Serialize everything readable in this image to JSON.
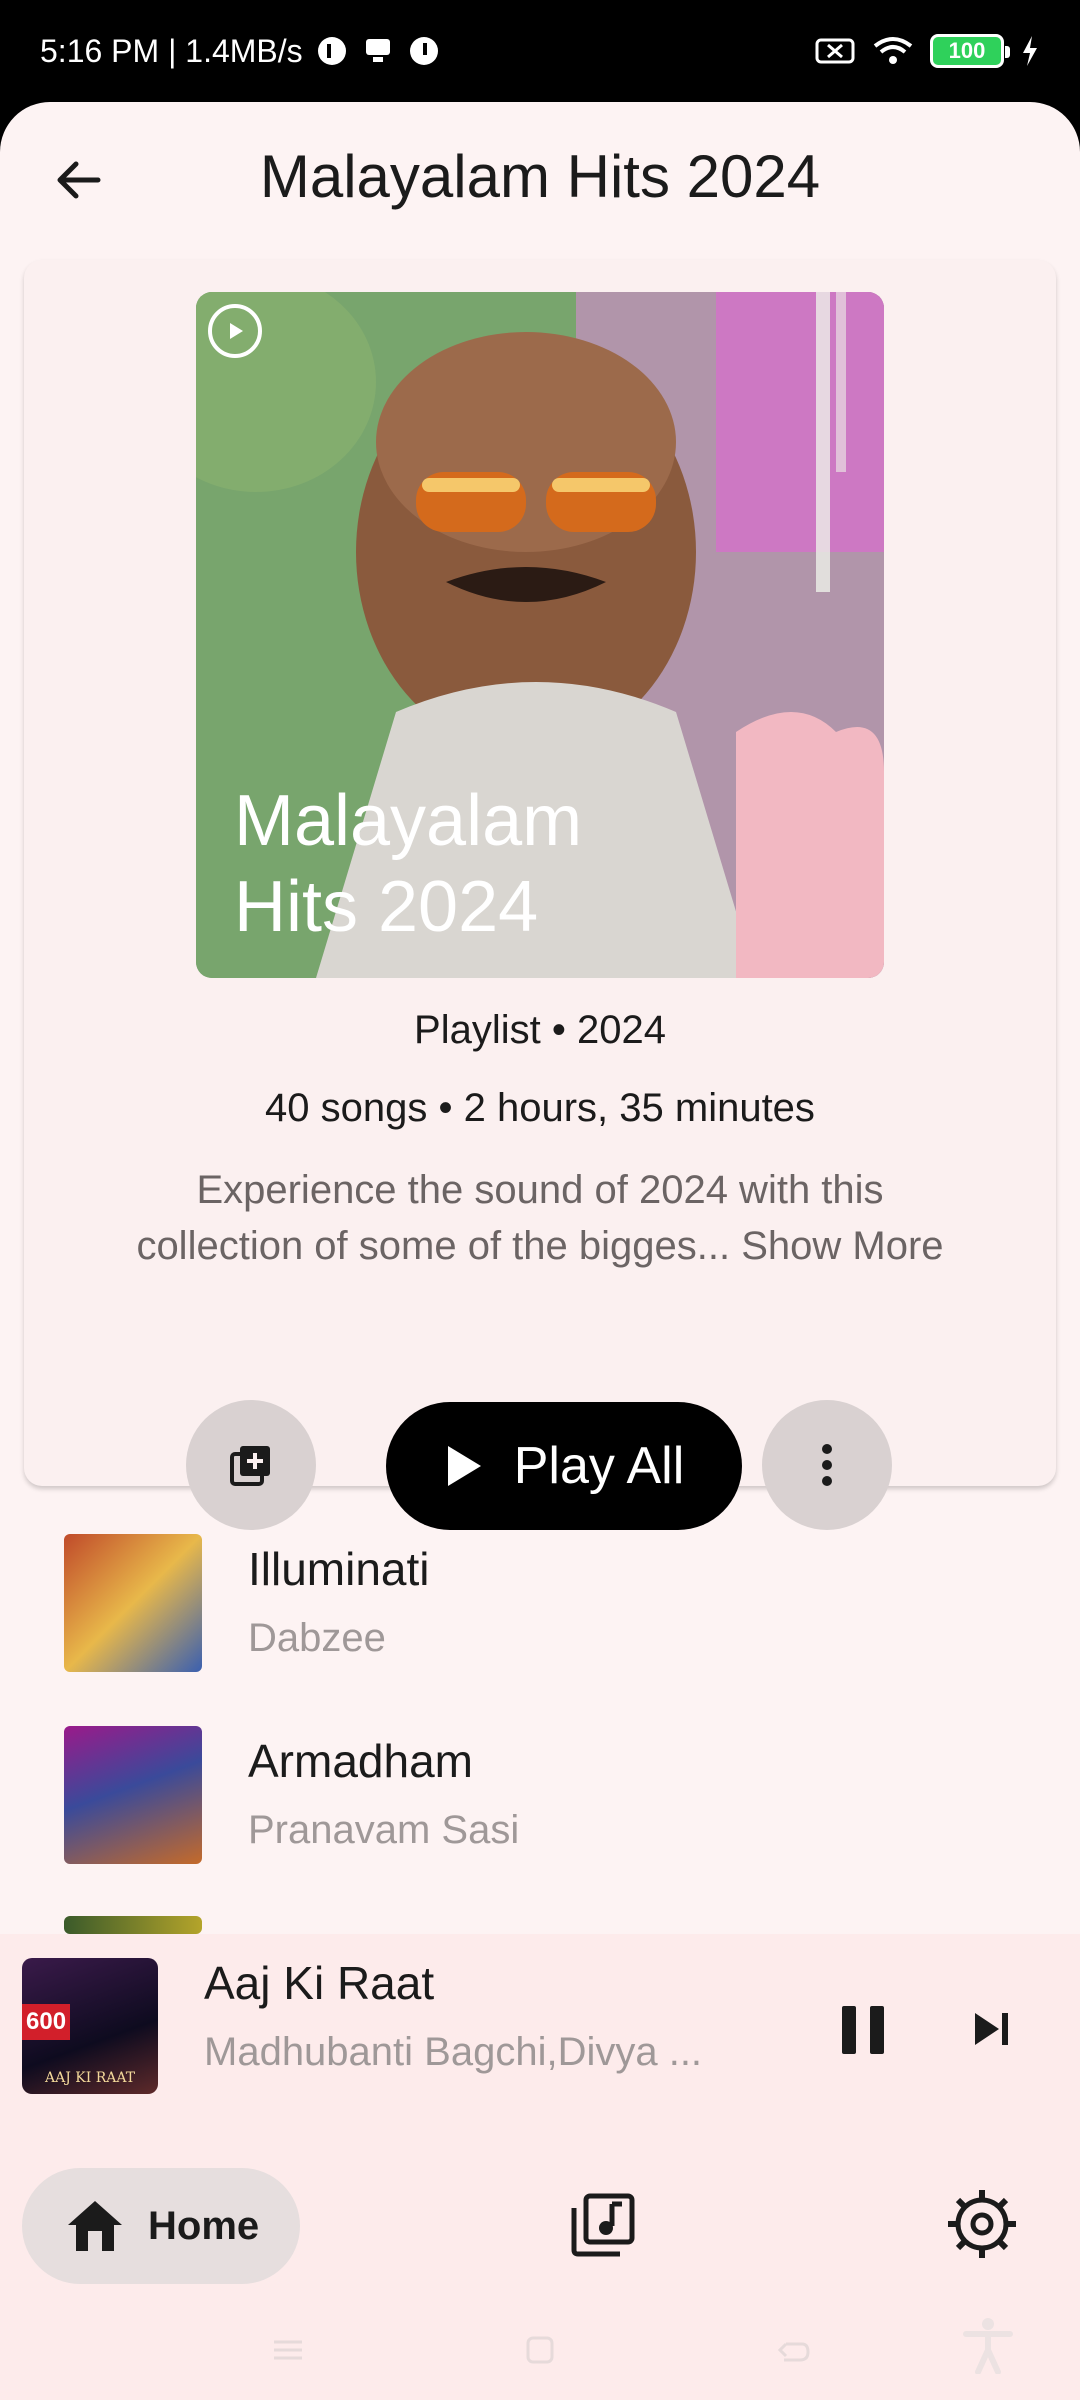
{
  "status_bar": {
    "time_speed": "5:16 PM | 1.4MB/s",
    "battery": "100"
  },
  "header": {
    "title": "Malayalam Hits 2024"
  },
  "playlist": {
    "cover_text": "Malayalam Hits 2024",
    "meta_type": "Playlist • 2024",
    "meta_stats": "40 songs • 2 hours, 35 minutes",
    "description_line1": "Experience the sound of 2024 with this",
    "description_line2": "collection of some of the bigges...",
    "show_more": "Show More",
    "play_all_label": "Play All"
  },
  "songs": [
    {
      "title": "Illuminati",
      "artist": "Dabzee"
    },
    {
      "title": "Armadham",
      "artist": "Pranavam Sasi"
    }
  ],
  "mini_player": {
    "title": "Aaj Ki Raat",
    "artist": "Madhubanti Bagchi,Divya ...",
    "thumb_text": "600",
    "thumb_caption": "AAJ KI RAAT"
  },
  "bottom_nav": {
    "home_label": "Home"
  },
  "colors": {
    "background": "#fdf3f3",
    "accent": "#000000",
    "secondary_text": "#9f9898"
  }
}
